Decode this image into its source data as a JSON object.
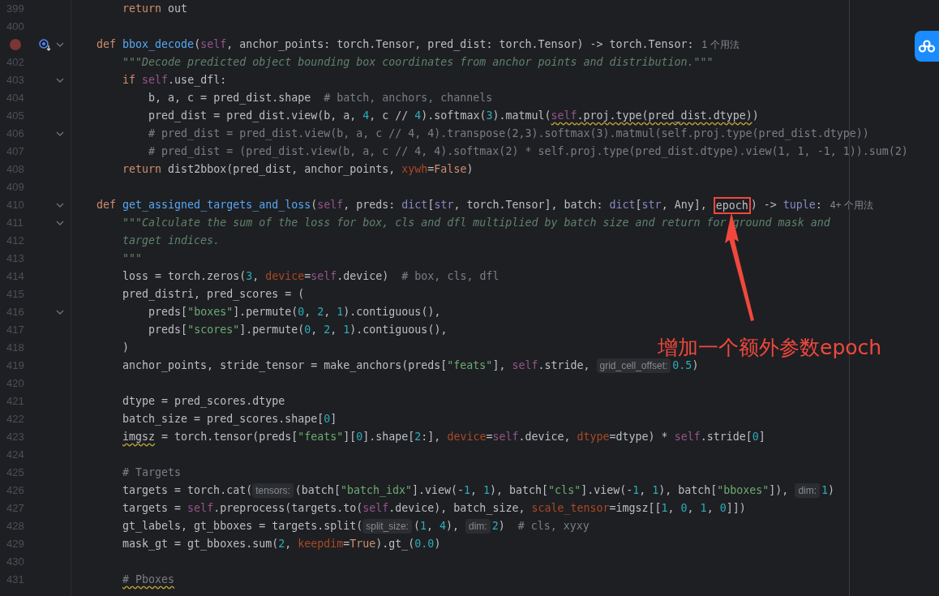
{
  "editor": {
    "lines": [
      {
        "number": "399",
        "breakpoint": false,
        "override": false,
        "fold": false,
        "tokens": [
          {
            "kind": "keyword",
            "text": "        return"
          },
          {
            "kind": "plain",
            "text": " out"
          }
        ]
      },
      {
        "number": "400",
        "breakpoint": false,
        "override": false,
        "fold": false
      },
      {
        "breakpoint": true,
        "override": true,
        "fold": true,
        "tokens": [
          {
            "kind": "keyword",
            "text": "    def "
          },
          {
            "kind": "function",
            "text": "bbox_decode"
          },
          {
            "kind": "plain",
            "text": "("
          },
          {
            "kind": "self",
            "text": "self"
          },
          {
            "kind": "plain",
            "text": ", anchor_points: torch.Tensor, pred_dist: torch.Tensor) -> torch.Tensor:"
          },
          {
            "kind": "usage",
            "text": "1 个用法"
          }
        ]
      },
      {
        "number": "402",
        "breakpoint": false,
        "override": false,
        "fold": false,
        "tokens": [
          {
            "kind": "docstring",
            "text": "        \"\"\"Decode predicted object bounding box coordinates from anchor points and distribution.\"\"\""
          }
        ]
      },
      {
        "number": "403",
        "breakpoint": false,
        "override": false,
        "fold": true,
        "tokens": [
          {
            "kind": "keyword",
            "text": "        if "
          },
          {
            "kind": "self",
            "text": "self"
          },
          {
            "kind": "plain",
            "text": ".use_dfl:"
          }
        ]
      },
      {
        "number": "404",
        "breakpoint": false,
        "override": false,
        "fold": false,
        "tokens": [
          {
            "kind": "plain",
            "text": "            b, a, c = pred_dist.shape  "
          },
          {
            "kind": "comment",
            "text": "# batch, anchors, channels"
          }
        ]
      },
      {
        "number": "405",
        "breakpoint": false,
        "override": false,
        "fold": false,
        "tokens": [
          {
            "kind": "plain",
            "text": "            pred_dist = pred_dist.view(b, a, "
          },
          {
            "kind": "number",
            "text": "4"
          },
          {
            "kind": "plain",
            "text": ", c // "
          },
          {
            "kind": "number",
            "text": "4"
          },
          {
            "kind": "plain",
            "text": ").softmax("
          },
          {
            "kind": "number",
            "text": "3"
          },
          {
            "kind": "plain",
            "text": ").matmul("
          },
          {
            "kind": "self_warning",
            "text": "self"
          },
          {
            "kind": "plain_warning",
            "text": ".proj.type(pred_dist.dtype)"
          },
          {
            "kind": "plain",
            "text": ")"
          }
        ]
      },
      {
        "number": "406",
        "breakpoint": false,
        "override": false,
        "fold": true,
        "tokens": [
          {
            "kind": "comment",
            "text": "            # pred_dist = pred_dist.view(b, a, c // 4, 4).transpose(2,3).softmax(3).matmul(self.proj.type(pred_dist.dtype))"
          }
        ]
      },
      {
        "number": "407",
        "breakpoint": false,
        "override": false,
        "fold": false,
        "tokens": [
          {
            "kind": "comment",
            "text": "            # pred_dist = (pred_dist.view(b, a, c // 4, 4).softmax(2) * self.proj.type(pred_dist.dtype).view(1, 1, -1, 1)).sum(2)"
          }
        ]
      },
      {
        "number": "408",
        "breakpoint": false,
        "override": false,
        "fold": false,
        "tokens": [
          {
            "kind": "keyword",
            "text": "        return"
          },
          {
            "kind": "plain",
            "text": " dist2bbox(pred_dist, anchor_points, "
          },
          {
            "kind": "param",
            "text": "xywh"
          },
          {
            "kind": "plain",
            "text": "="
          },
          {
            "kind": "keyword",
            "text": "False"
          },
          {
            "kind": "plain",
            "text": ")"
          }
        ]
      },
      {
        "number": "409",
        "breakpoint": false,
        "override": false,
        "fold": false
      },
      {
        "number": "410",
        "breakpoint": false,
        "override": false,
        "fold": true,
        "tokens": [
          {
            "kind": "keyword",
            "text": "    def "
          },
          {
            "kind": "function",
            "text": "get_assigned_targets_and_loss"
          },
          {
            "kind": "plain",
            "text": "("
          },
          {
            "kind": "self",
            "text": "self"
          },
          {
            "kind": "plain",
            "text": ", preds: "
          },
          {
            "kind": "builtin",
            "text": "dict"
          },
          {
            "kind": "plain",
            "text": "["
          },
          {
            "kind": "builtin",
            "text": "str"
          },
          {
            "kind": "plain",
            "text": ", torch.Tensor], batch: "
          },
          {
            "kind": "builtin",
            "text": "dict"
          },
          {
            "kind": "plain",
            "text": "["
          },
          {
            "kind": "builtin",
            "text": "str"
          },
          {
            "kind": "plain",
            "text": ", Any], "
          },
          {
            "kind": "boxed",
            "text": "epoch"
          },
          {
            "kind": "plain",
            "text": ") -> "
          },
          {
            "kind": "builtin",
            "text": "tuple"
          },
          {
            "kind": "plain",
            "text": ":"
          },
          {
            "kind": "usage",
            "text": "4+ 个用法"
          }
        ]
      },
      {
        "number": "411",
        "breakpoint": false,
        "override": false,
        "fold": true,
        "tokens": [
          {
            "kind": "docstring",
            "text": "        \"\"\"Calculate the sum of the loss for box, cls and dfl multiplied by batch size and return for"
          },
          {
            "kind": "docstring",
            "text": " ground mask and"
          }
        ]
      },
      {
        "number": "412",
        "breakpoint": false,
        "override": false,
        "fold": false,
        "tokens": [
          {
            "kind": "docstring",
            "text": "        target indices."
          }
        ]
      },
      {
        "number": "413",
        "breakpoint": false,
        "override": false,
        "fold": false,
        "tokens": [
          {
            "kind": "docstring",
            "text": "        \"\"\""
          }
        ]
      },
      {
        "number": "414",
        "breakpoint": false,
        "override": false,
        "fold": false,
        "tokens": [
          {
            "kind": "plain",
            "text": "        loss = torch.zeros("
          },
          {
            "kind": "number",
            "text": "3"
          },
          {
            "kind": "plain",
            "text": ", "
          },
          {
            "kind": "param",
            "text": "device"
          },
          {
            "kind": "plain",
            "text": "="
          },
          {
            "kind": "self",
            "text": "self"
          },
          {
            "kind": "plain",
            "text": ".device)  "
          },
          {
            "kind": "comment",
            "text": "# box, cls, dfl"
          }
        ]
      },
      {
        "number": "415",
        "breakpoint": false,
        "override": false,
        "fold": false,
        "tokens": [
          {
            "kind": "plain",
            "text": "        pred_distri, pred_scores = ("
          }
        ]
      },
      {
        "number": "416",
        "breakpoint": false,
        "override": false,
        "fold": true,
        "tokens": [
          {
            "kind": "plain",
            "text": "            preds["
          },
          {
            "kind": "string",
            "text": "\"boxes\""
          },
          {
            "kind": "plain",
            "text": "].permute("
          },
          {
            "kind": "number",
            "text": "0"
          },
          {
            "kind": "plain",
            "text": ", "
          },
          {
            "kind": "number",
            "text": "2"
          },
          {
            "kind": "plain",
            "text": ", "
          },
          {
            "kind": "number",
            "text": "1"
          },
          {
            "kind": "plain",
            "text": ").contiguous(),"
          }
        ]
      },
      {
        "number": "417",
        "breakpoint": false,
        "override": false,
        "fold": false,
        "tokens": [
          {
            "kind": "plain",
            "text": "            preds["
          },
          {
            "kind": "string",
            "text": "\"scores\""
          },
          {
            "kind": "plain",
            "text": "].permute("
          },
          {
            "kind": "number",
            "text": "0"
          },
          {
            "kind": "plain",
            "text": ", "
          },
          {
            "kind": "number",
            "text": "2"
          },
          {
            "kind": "plain",
            "text": ", "
          },
          {
            "kind": "number",
            "text": "1"
          },
          {
            "kind": "plain",
            "text": ").contiguous(),"
          }
        ]
      },
      {
        "number": "418",
        "breakpoint": false,
        "override": false,
        "fold": false,
        "tokens": [
          {
            "kind": "plain",
            "text": "        )"
          }
        ]
      },
      {
        "number": "419",
        "breakpoint": false,
        "override": false,
        "fold": false,
        "tokens": [
          {
            "kind": "plain",
            "text": "        anchor_points, stride_tensor = make_anchors(preds["
          },
          {
            "kind": "string",
            "text": "\"feats\""
          },
          {
            "kind": "plain",
            "text": "], "
          },
          {
            "kind": "self",
            "text": "self"
          },
          {
            "kind": "plain",
            "text": ".stride, "
          },
          {
            "kind": "hint",
            "text": "grid_cell_offset:"
          },
          {
            "kind": "number",
            "text": "0.5"
          },
          {
            "kind": "plain",
            "text": ")"
          }
        ]
      },
      {
        "number": "420",
        "breakpoint": false,
        "override": false,
        "fold": false
      },
      {
        "number": "421",
        "breakpoint": false,
        "override": false,
        "fold": false,
        "tokens": [
          {
            "kind": "plain",
            "text": "        dtype = pred_scores.dtype"
          }
        ]
      },
      {
        "number": "422",
        "breakpoint": false,
        "override": false,
        "fold": false,
        "tokens": [
          {
            "kind": "plain",
            "text": "        batch_size = pred_scores.shape["
          },
          {
            "kind": "number",
            "text": "0"
          },
          {
            "kind": "plain",
            "text": "]"
          }
        ]
      },
      {
        "number": "423",
        "breakpoint": false,
        "override": false,
        "fold": false,
        "tokens": [
          {
            "kind": "plain_warning",
            "text": "        imgsz"
          },
          {
            "kind": "plain",
            "text": " = torch.tensor(preds["
          },
          {
            "kind": "string",
            "text": "\"feats\""
          },
          {
            "kind": "plain",
            "text": "]["
          },
          {
            "kind": "number",
            "text": "0"
          },
          {
            "kind": "plain",
            "text": "].shape["
          },
          {
            "kind": "number",
            "text": "2"
          },
          {
            "kind": "plain",
            "text": ":], "
          },
          {
            "kind": "param",
            "text": "device"
          },
          {
            "kind": "plain",
            "text": "="
          },
          {
            "kind": "self",
            "text": "self"
          },
          {
            "kind": "plain",
            "text": ".device, "
          },
          {
            "kind": "param",
            "text": "dtype"
          },
          {
            "kind": "plain",
            "text": "=dtype) * "
          },
          {
            "kind": "self",
            "text": "self"
          },
          {
            "kind": "plain",
            "text": ".stride["
          },
          {
            "kind": "number",
            "text": "0"
          },
          {
            "kind": "plain",
            "text": "]"
          }
        ]
      },
      {
        "number": "424",
        "breakpoint": false,
        "override": false,
        "fold": false
      },
      {
        "number": "425",
        "breakpoint": false,
        "override": false,
        "fold": false,
        "tokens": [
          {
            "kind": "comment",
            "text": "        # Targets"
          }
        ]
      },
      {
        "number": "426",
        "breakpoint": false,
        "override": false,
        "fold": false,
        "tokens": [
          {
            "kind": "plain",
            "text": "        targets = torch.cat("
          },
          {
            "kind": "hint",
            "text": "tensors:"
          },
          {
            "kind": "plain",
            "text": "(batch["
          },
          {
            "kind": "string",
            "text": "\"batch_idx\""
          },
          {
            "kind": "plain",
            "text": "].view(-"
          },
          {
            "kind": "number",
            "text": "1"
          },
          {
            "kind": "plain",
            "text": ", "
          },
          {
            "kind": "number",
            "text": "1"
          },
          {
            "kind": "plain",
            "text": "), batch["
          },
          {
            "kind": "string",
            "text": "\"cls\""
          },
          {
            "kind": "plain",
            "text": "].view(-"
          },
          {
            "kind": "number",
            "text": "1"
          },
          {
            "kind": "plain",
            "text": ", "
          },
          {
            "kind": "number",
            "text": "1"
          },
          {
            "kind": "plain",
            "text": "), batch["
          },
          {
            "kind": "string",
            "text": "\"bboxes\""
          },
          {
            "kind": "plain",
            "text": "]), "
          },
          {
            "kind": "hint",
            "text": "dim:"
          },
          {
            "kind": "number",
            "text": "1"
          },
          {
            "kind": "plain",
            "text": ")"
          }
        ]
      },
      {
        "number": "427",
        "breakpoint": false,
        "override": false,
        "fold": false,
        "tokens": [
          {
            "kind": "plain",
            "text": "        targets = "
          },
          {
            "kind": "self",
            "text": "self"
          },
          {
            "kind": "plain",
            "text": ".preprocess(targets.to("
          },
          {
            "kind": "self",
            "text": "self"
          },
          {
            "kind": "plain",
            "text": ".device), batch_size, "
          },
          {
            "kind": "param",
            "text": "scale_tensor"
          },
          {
            "kind": "plain",
            "text": "=imgsz[["
          },
          {
            "kind": "number",
            "text": "1"
          },
          {
            "kind": "plain",
            "text": ", "
          },
          {
            "kind": "number",
            "text": "0"
          },
          {
            "kind": "plain",
            "text": ", "
          },
          {
            "kind": "number",
            "text": "1"
          },
          {
            "kind": "plain",
            "text": ", "
          },
          {
            "kind": "number",
            "text": "0"
          },
          {
            "kind": "plain",
            "text": "]])"
          }
        ]
      },
      {
        "number": "428",
        "breakpoint": false,
        "override": false,
        "fold": false,
        "tokens": [
          {
            "kind": "plain",
            "text": "        gt_labels, gt_bboxes = targets.split("
          },
          {
            "kind": "hint",
            "text": "split_size:"
          },
          {
            "kind": "plain",
            "text": "("
          },
          {
            "kind": "number",
            "text": "1"
          },
          {
            "kind": "plain",
            "text": ", "
          },
          {
            "kind": "number",
            "text": "4"
          },
          {
            "kind": "plain",
            "text": "), "
          },
          {
            "kind": "hint",
            "text": "dim:"
          },
          {
            "kind": "number",
            "text": "2"
          },
          {
            "kind": "plain",
            "text": ")  "
          },
          {
            "kind": "comment",
            "text": "# cls, xyxy"
          }
        ]
      },
      {
        "number": "429",
        "breakpoint": false,
        "override": false,
        "fold": false,
        "tokens": [
          {
            "kind": "plain",
            "text": "        mask_gt = gt_bboxes.sum("
          },
          {
            "kind": "number",
            "text": "2"
          },
          {
            "kind": "plain",
            "text": ", "
          },
          {
            "kind": "param",
            "text": "keepdim"
          },
          {
            "kind": "plain",
            "text": "="
          },
          {
            "kind": "keyword",
            "text": "True"
          },
          {
            "kind": "plain",
            "text": ").gt_("
          },
          {
            "kind": "number",
            "text": "0.0"
          },
          {
            "kind": "plain",
            "text": ")"
          }
        ]
      },
      {
        "number": "430",
        "breakpoint": false,
        "override": false,
        "fold": false
      },
      {
        "number": "431",
        "breakpoint": false,
        "override": false,
        "fold": false,
        "tokens": [
          {
            "kind": "comment_warning",
            "text": "        # Pboxes"
          }
        ]
      }
    ]
  },
  "annotation": {
    "text": "增加一个额外参数epoch"
  }
}
